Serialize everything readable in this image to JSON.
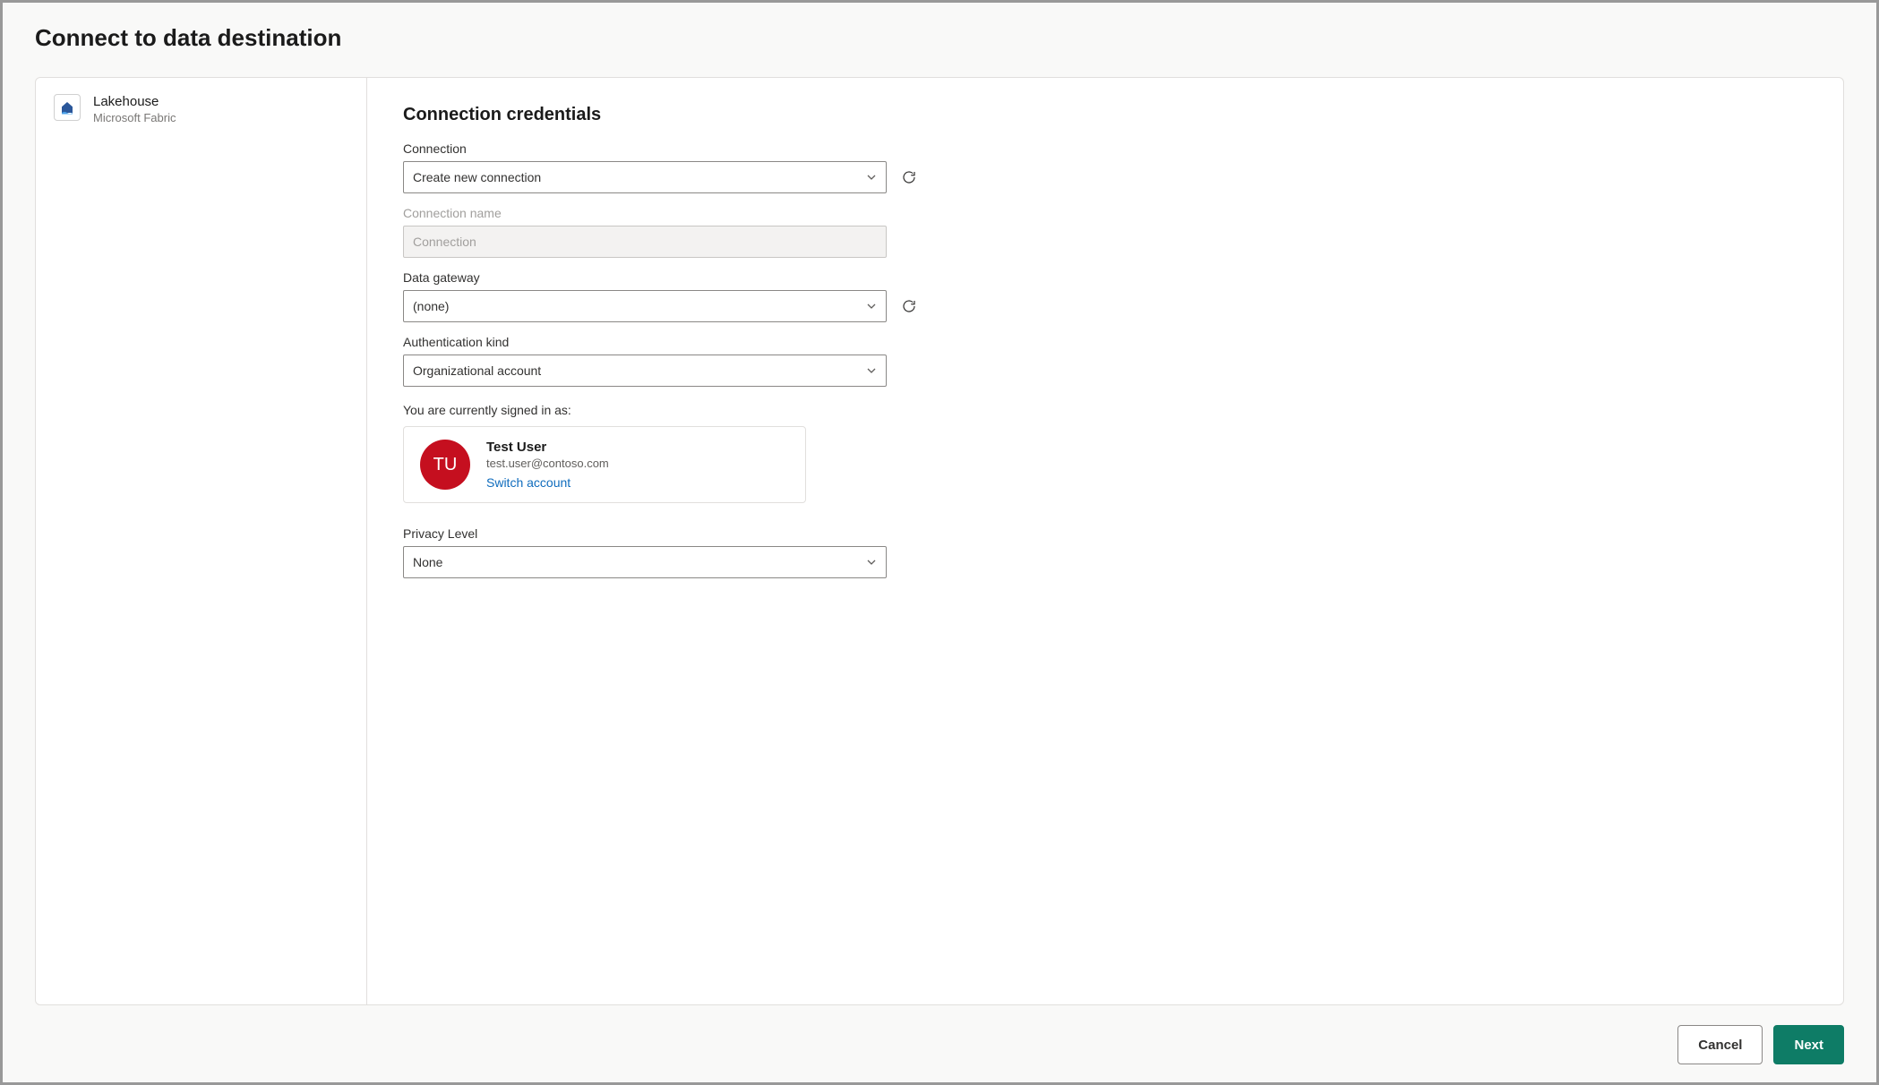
{
  "dialog": {
    "title": "Connect to data destination"
  },
  "source": {
    "name": "Lakehouse",
    "subtitle": "Microsoft Fabric"
  },
  "form": {
    "heading": "Connection credentials",
    "connection": {
      "label": "Connection",
      "value": "Create new connection"
    },
    "connection_name": {
      "label": "Connection name",
      "value": "Connection"
    },
    "data_gateway": {
      "label": "Data gateway",
      "value": "(none)"
    },
    "auth_kind": {
      "label": "Authentication kind",
      "value": "Organizational account"
    },
    "signed_in_label": "You are currently signed in as:",
    "account": {
      "initials": "TU",
      "name": "Test User",
      "email": "test.user@contoso.com",
      "switch_label": "Switch account"
    },
    "privacy": {
      "label": "Privacy Level",
      "value": "None"
    }
  },
  "footer": {
    "cancel": "Cancel",
    "next": "Next"
  }
}
